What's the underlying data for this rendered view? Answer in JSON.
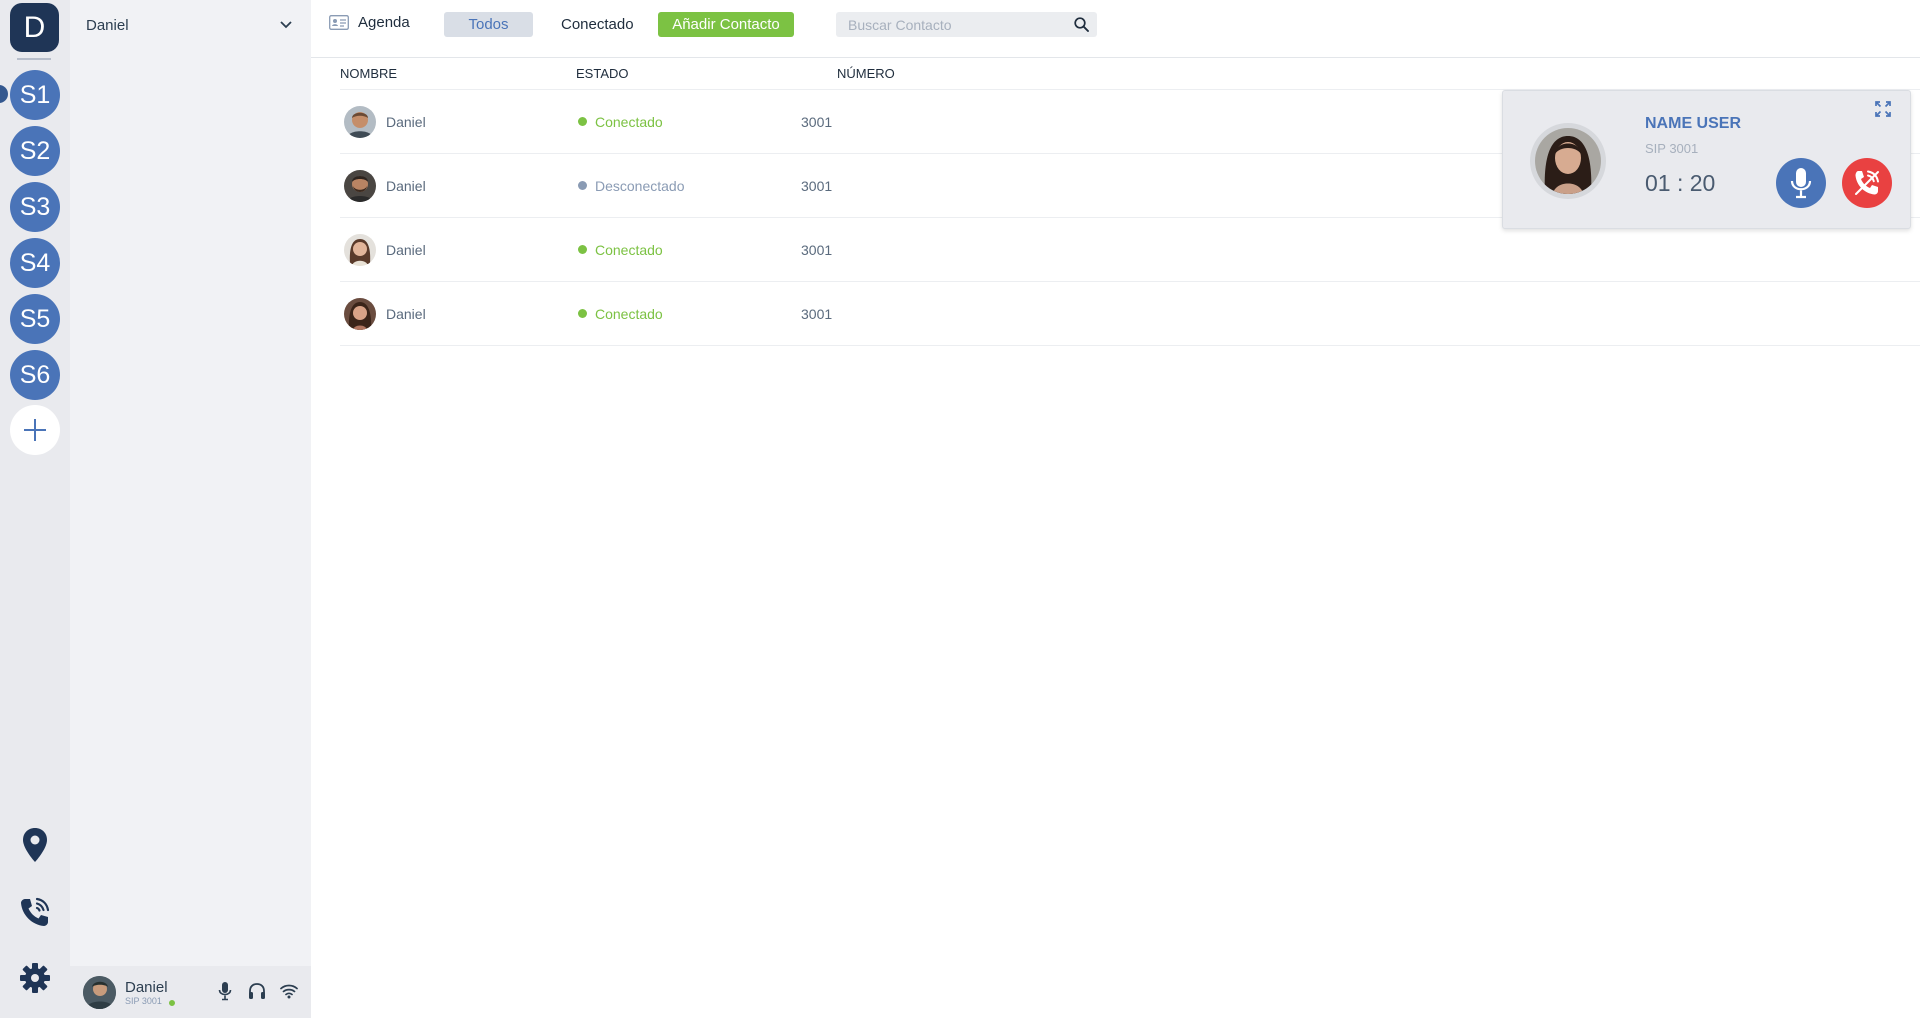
{
  "rail": {
    "top_label": "D",
    "servers": [
      "S1",
      "S2",
      "S3",
      "S4",
      "S5",
      "S6"
    ],
    "active_server": "S1",
    "add_icon": "plus-icon",
    "bottom_icons": [
      "location-pin-icon",
      "phone-ringing-icon",
      "gear-icon"
    ],
    "accent_color": "#4a74b8"
  },
  "account": {
    "name": "Daniel",
    "dropdown_icon": "chevron-down-icon"
  },
  "user_bar": {
    "name": "Daniel",
    "sip": "SIP 3001",
    "status_color": "#7cc243",
    "icons": [
      "microphone-icon",
      "headphones-icon",
      "wifi-icon"
    ]
  },
  "toolbar": {
    "agenda_label": "Agenda",
    "tab_all": "Todos",
    "tab_connected": "Conectado",
    "add_button": "Añadir Contacto",
    "search_placeholder": "Buscar Contacto"
  },
  "table": {
    "headers": [
      "NOMBRE",
      "ESTADO",
      "NÚMERO"
    ],
    "rows": [
      {
        "name": "Daniel",
        "status": "Conectado",
        "status_color": "#7cc243",
        "number": "3001"
      },
      {
        "name": "Daniel",
        "status": "Desconectado",
        "status_color": "#8a9bb4",
        "number": "3001"
      },
      {
        "name": "Daniel",
        "status": "Conectado",
        "status_color": "#7cc243",
        "number": "3001"
      },
      {
        "name": "Daniel",
        "status": "Conectado",
        "status_color": "#7cc243",
        "number": "3001"
      }
    ]
  },
  "call": {
    "name": "NAME USER",
    "sip": "SIP 3001",
    "timer": "01 : 20",
    "mute_icon": "microphone-icon",
    "hangup_icon": "hang-up-phone-icon",
    "expand_icon": "expand-icon"
  }
}
